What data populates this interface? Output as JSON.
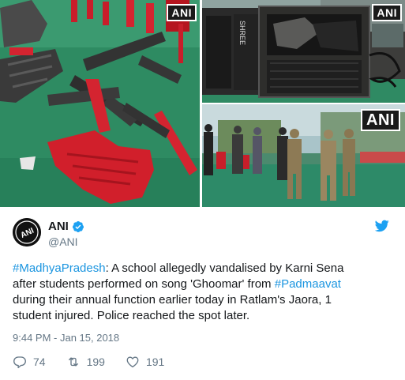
{
  "media": {
    "watermark_small": "ANI",
    "watermark_large": "ANI",
    "speaker_brand": "SHREE"
  },
  "author": {
    "name": "ANI",
    "handle": "@ANI",
    "avatar_text": "ANI",
    "verified": true
  },
  "tweet": {
    "segments": [
      {
        "type": "hashtag",
        "text": "#MadhyaPradesh"
      },
      {
        "type": "text",
        "text": ": A school allegedly vandalised by Karni Sena\nafter students performed on song 'Ghoomar' from "
      },
      {
        "type": "hashtag",
        "text": "#Padmaavat"
      },
      {
        "type": "text",
        "text": "\nduring their annual function earlier today in Ratlam's Jaora, 1\nstudent injured. Police reached the spot later."
      }
    ],
    "timestamp": "9:44 PM - Jan 15, 2018"
  },
  "actions": {
    "replies": "74",
    "retweets": "199",
    "likes": "191"
  },
  "colors": {
    "link": "#1b95e0",
    "muted": "#657786",
    "text": "#14171a",
    "twitter_blue": "#1da1f2"
  }
}
